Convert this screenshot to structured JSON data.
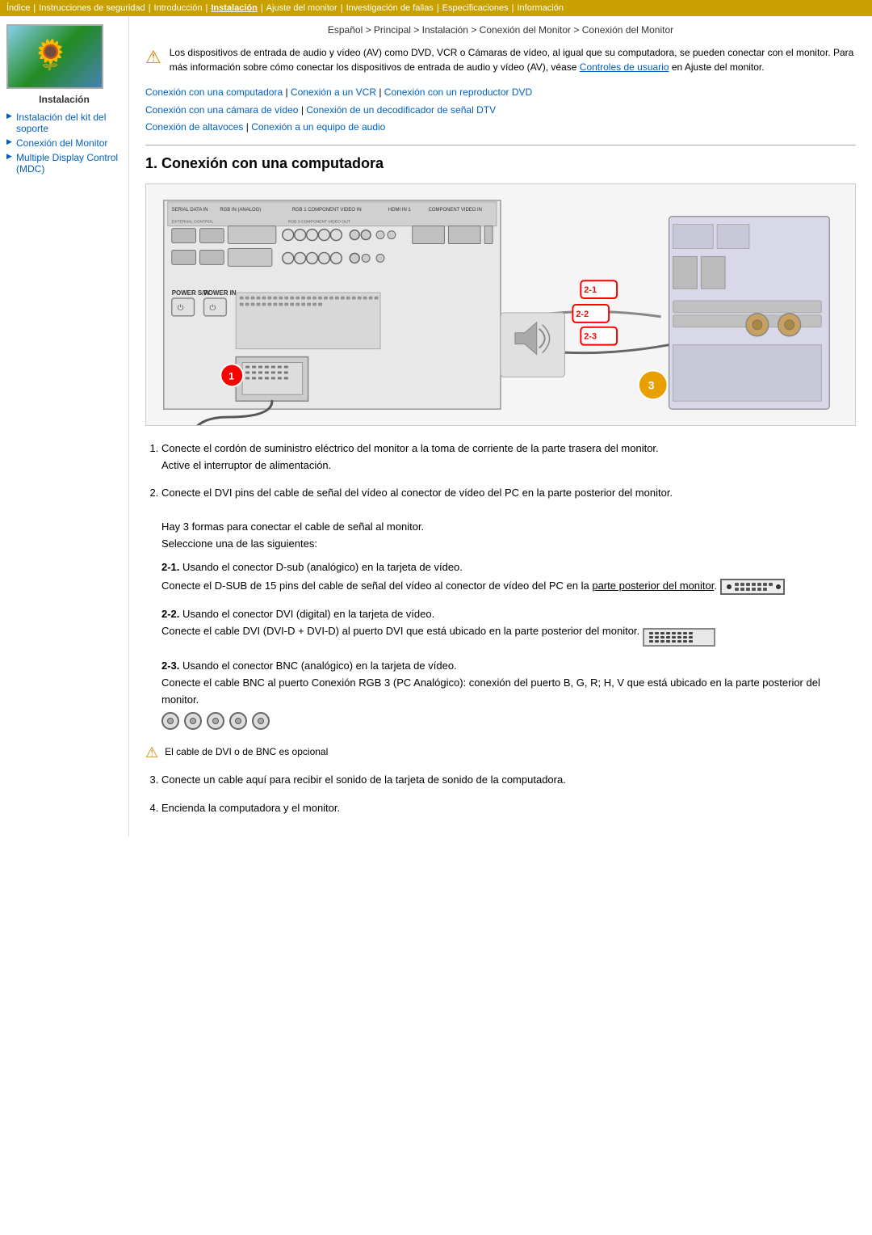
{
  "topnav": {
    "items": [
      {
        "label": "Índice",
        "active": false
      },
      {
        "label": "Instrucciones de seguridad",
        "active": false
      },
      {
        "label": "Introducción",
        "active": false
      },
      {
        "label": "Instalación",
        "active": true
      },
      {
        "label": "Ajuste del monitor",
        "active": false
      },
      {
        "label": "Investigación de fallas",
        "active": false
      },
      {
        "label": "Especificaciones",
        "active": false
      },
      {
        "label": "Información",
        "active": false
      }
    ]
  },
  "breadcrumb": "Español > Principal > Instalación > Conexión del Monitor > Conexión del Monitor",
  "sidebar": {
    "label": "Instalación",
    "items": [
      {
        "label": "Instalación del kit del soporte",
        "active": false
      },
      {
        "label": "Conexión del Monitor",
        "active": true
      },
      {
        "label": "Multiple Display Control (MDC)",
        "active": false
      }
    ]
  },
  "note_text": "Los dispositivos de entrada de audio y vídeo (AV) como DVD, VCR o Cámaras de vídeo, al igual que su computadora, se pueden conectar con el monitor. Para más información sobre cómo conectar los dispositivos de entrada de audio y vídeo (AV), véase Controles de usuario en Ajuste del monitor.",
  "links": [
    "Conexión con una computadora",
    "Conexión a un VCR",
    "Conexión con un reproductor DVD",
    "Conexión con una cámara de vídeo",
    "Conexión de un decodificador de señal DTV",
    "Conexión de altavoces",
    "Conexión a un equipo de audio"
  ],
  "section1": {
    "heading": "1. Conexión con una computadora",
    "steps": [
      {
        "num": "1",
        "text": "Conecte el cordón de suministro eléctrico del monitor a la toma de corriente de la parte trasera del monitor.",
        "subtext": "Active el interruptor de alimentación."
      },
      {
        "num": "2",
        "text": "Conecte el DVI pins del cable de señal del vídeo al conector de vídeo del PC en la parte posterior del monitor.",
        "subtext": "Hay 3 formas para conectar el cable de señal al monitor.\nSeleccione una de las siguientes:",
        "substeps": [
          {
            "label": "2-1.",
            "text": "Usando el conector D-sub (analógico) en la tarjeta de vídeo.",
            "subtext": "Conecte el D-SUB de 15 pins del cable de señal del vídeo al conector de vídeo del PC en la parte posterior del monitor.",
            "connector_type": "dsub"
          },
          {
            "label": "2-2.",
            "text": "Usando el conector DVI (digital) en la tarjeta de vídeo.",
            "subtext": "Conecte el cable DVI (DVI-D + DVI-D) al puerto DVI que está ubicado en la parte posterior del monitor.",
            "connector_type": "dvi"
          },
          {
            "label": "2-3.",
            "text": "Usando el conector BNC (analógico) en la tarjeta de vídeo.",
            "subtext": "Conecte el cable BNC al puerto Conexión RGB 3 (PC Analógico): conexión del puerto B, G, R; H, V que está ubicado en la parte posterior del monitor.",
            "connector_type": "bnc"
          }
        ]
      },
      {
        "num": "3",
        "text": "Conecte un cable aquí para recibir el sonido de la tarjeta de sonido de la computadora."
      },
      {
        "num": "4",
        "text": "Encienda la computadora y el monitor."
      }
    ],
    "optional_note": "El cable de DVI o de BNC es opcional"
  }
}
